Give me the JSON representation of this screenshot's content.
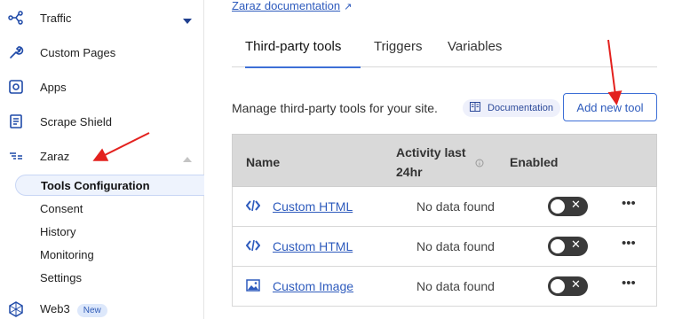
{
  "sidebar": {
    "items": [
      {
        "label": "Traffic",
        "icon": "traffic-icon"
      },
      {
        "label": "Custom Pages",
        "icon": "wrench-icon"
      },
      {
        "label": "Apps",
        "icon": "apps-icon"
      },
      {
        "label": "Scrape Shield",
        "icon": "document-icon"
      },
      {
        "label": "Zaraz",
        "icon": "zaraz-icon"
      }
    ],
    "zaraz_sub": [
      "Tools Configuration",
      "Consent",
      "History",
      "Monitoring",
      "Settings"
    ],
    "web3": {
      "label": "Web3",
      "badge": "New"
    }
  },
  "main": {
    "doc_link": "Zaraz documentation",
    "tabs": [
      "Third-party tools",
      "Triggers",
      "Variables"
    ],
    "description": "Manage third-party tools for your site.",
    "doc_pill": "Documentation",
    "add_button": "Add new tool",
    "table": {
      "headers": {
        "name": "Name",
        "activity_line1": "Activity last",
        "activity_line2": "24hr",
        "enabled": "Enabled"
      },
      "rows": [
        {
          "name": "Custom HTML",
          "activity": "No data found",
          "icon": "code-icon",
          "enabled": false
        },
        {
          "name": "Custom HTML",
          "activity": "No data found",
          "icon": "code-icon",
          "enabled": false
        },
        {
          "name": "Custom Image",
          "activity": "No data found",
          "icon": "image-icon",
          "enabled": false
        }
      ]
    }
  },
  "colors": {
    "accent": "#2e5bbd",
    "arrow": "#e3211e",
    "toggle_off": "#3a3a3a"
  }
}
